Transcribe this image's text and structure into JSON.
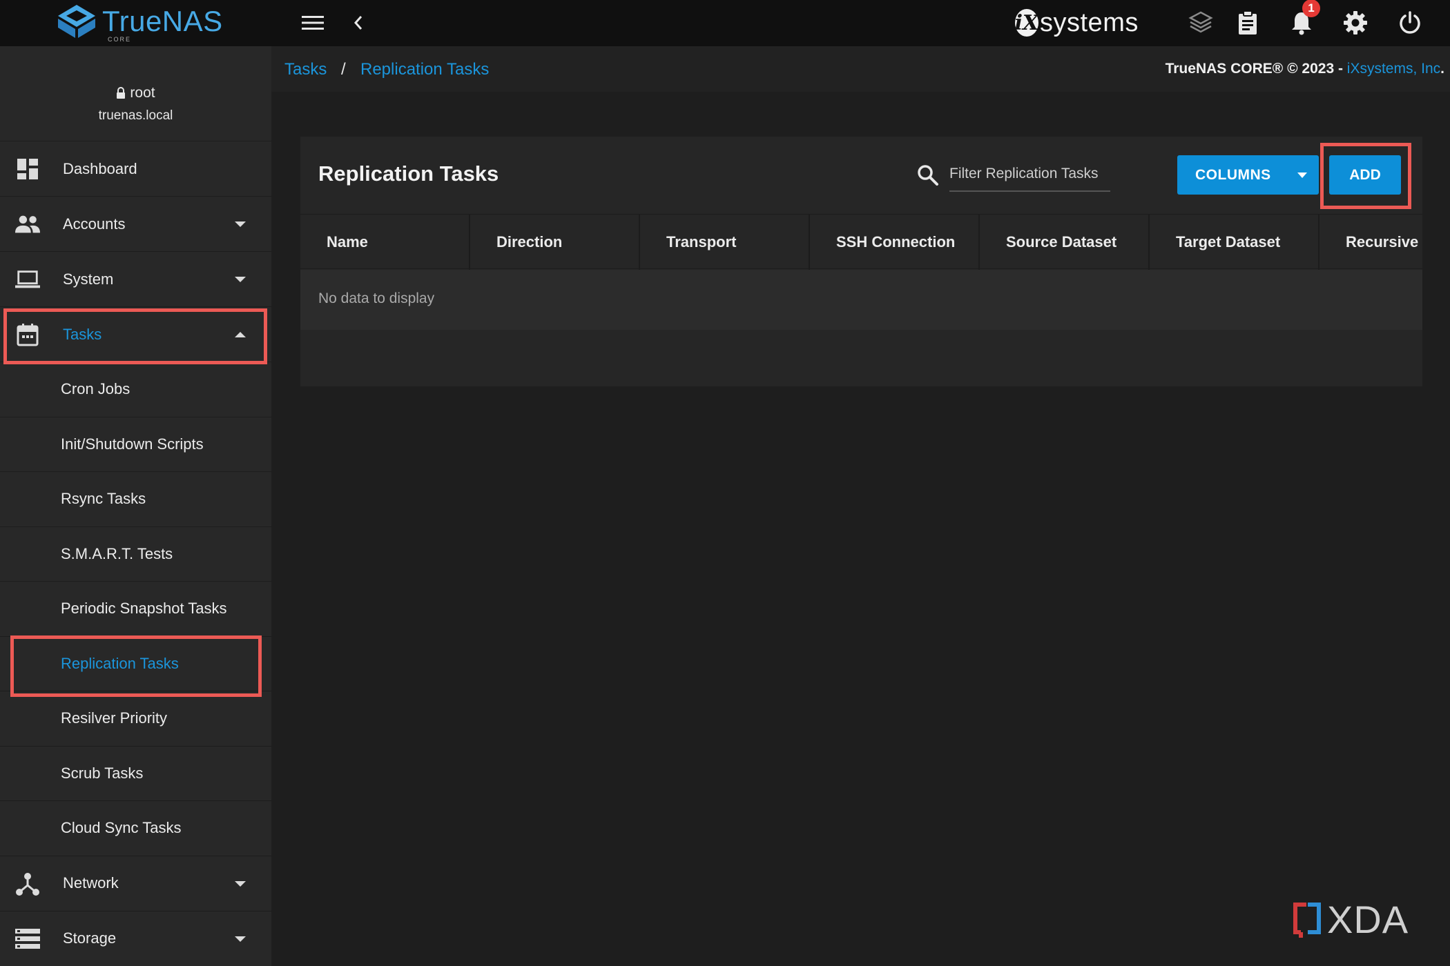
{
  "topbar": {
    "logo_text": "TrueNAS",
    "logo_sub": "CORE",
    "vendor_logo": "systems",
    "notification_count": "1",
    "icons": [
      "menu-icon",
      "back-chevron-icon",
      "apps-cube-icon",
      "clipboard-icon",
      "bell-icon",
      "gear-icon",
      "power-icon"
    ]
  },
  "sidebar": {
    "user": "root",
    "host": "truenas.local",
    "nav": [
      {
        "label": "Dashboard",
        "icon": "dashboard-icon"
      },
      {
        "label": "Accounts",
        "icon": "accounts-icon"
      },
      {
        "label": "System",
        "icon": "laptop-icon"
      },
      {
        "label": "Tasks",
        "icon": "calendar-icon"
      }
    ],
    "tasks_sub": [
      "Cron Jobs",
      "Init/Shutdown Scripts",
      "Rsync Tasks",
      "S.M.A.R.T. Tests",
      "Periodic Snapshot Tasks",
      "Replication Tasks",
      "Resilver Priority",
      "Scrub Tasks",
      "Cloud Sync Tasks"
    ],
    "nav_bottom": [
      {
        "label": "Network",
        "icon": "network-icon"
      },
      {
        "label": "Storage",
        "icon": "storage-icon"
      }
    ]
  },
  "breadcrumb": {
    "parent": "Tasks",
    "separator": "/",
    "current": "Replication Tasks"
  },
  "copyright": {
    "text": "TrueNAS CORE® © 2023 - ",
    "link": "iXsystems, Inc",
    "end": "."
  },
  "card": {
    "title": "Replication Tasks",
    "search_placeholder": "Filter Replication Tasks",
    "columns_label": "COLUMNS",
    "add_label": "ADD",
    "headers": [
      "Name",
      "Direction",
      "Transport",
      "SSH Connection",
      "Source Dataset",
      "Target Dataset",
      "Recursive"
    ],
    "empty_message": "No data to display"
  },
  "watermark": "XDA",
  "colors": {
    "accent": "#1b95db",
    "button": "#0d8fd8",
    "highlight": "#ec5a55",
    "topbar": "#101010",
    "sidebar": "#282828"
  }
}
